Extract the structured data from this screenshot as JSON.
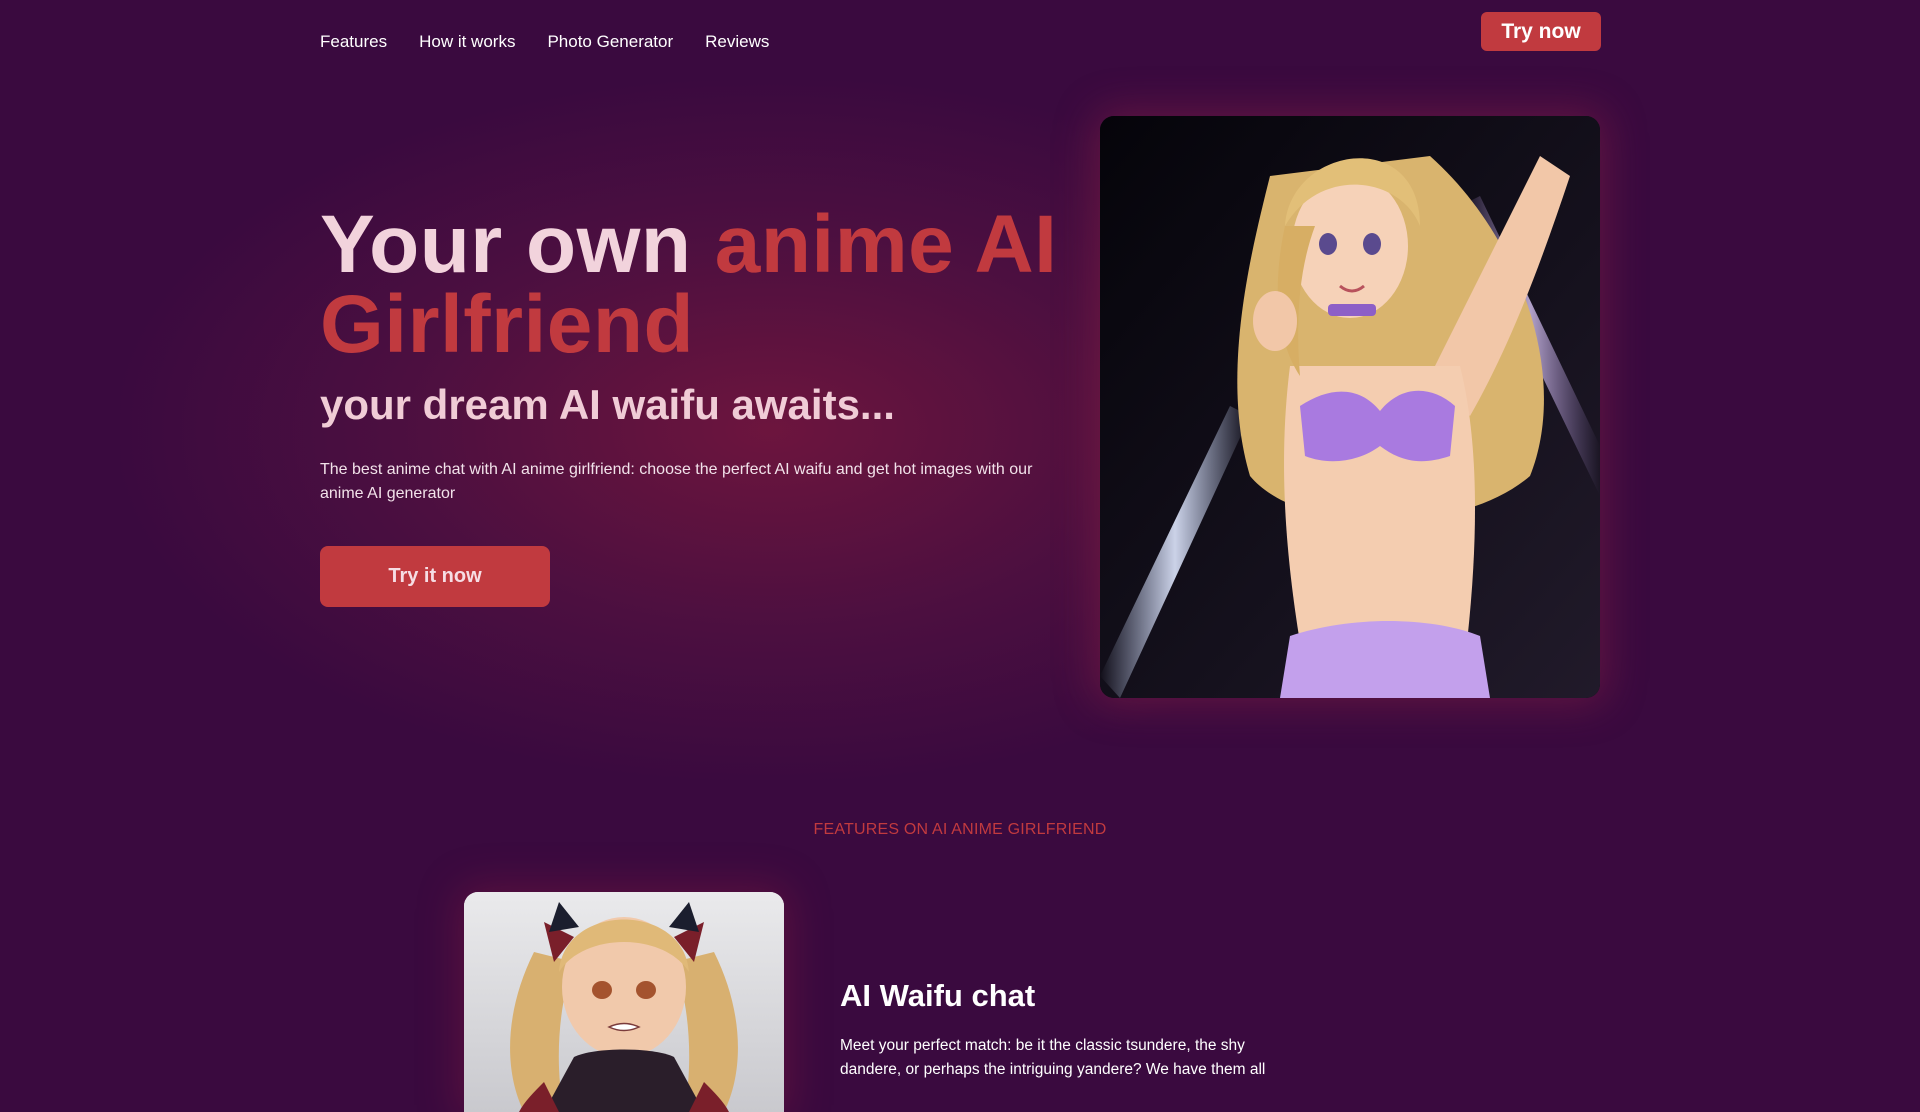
{
  "nav": {
    "links": [
      "Features",
      "How it works",
      "Photo Generator",
      "Reviews"
    ],
    "cta_label": "Try now"
  },
  "hero": {
    "title_part1": "Your own ",
    "title_part2": "anime AI Girlfriend",
    "subtitle": "your dream AI waifu awaits...",
    "description": "The best anime chat with AI anime girlfriend: choose the perfect AI waifu and get hot images with our anime AI generator",
    "cta_label": "Try it now",
    "image_alt": "anime girl illustration"
  },
  "features": {
    "section_label": "FEATURES ON AI ANIME GIRLFRIEND",
    "items": [
      {
        "title": "AI Waifu chat",
        "description": "Meet your perfect match: be it the classic tsundere, the shy dandere, or perhaps the intriguing yandere? We have them all",
        "image_alt": "anime girl with twin tails"
      }
    ]
  },
  "colors": {
    "background": "#3a0a3f",
    "accent": "#c13a3f",
    "title_light": "#f2d3dc"
  }
}
